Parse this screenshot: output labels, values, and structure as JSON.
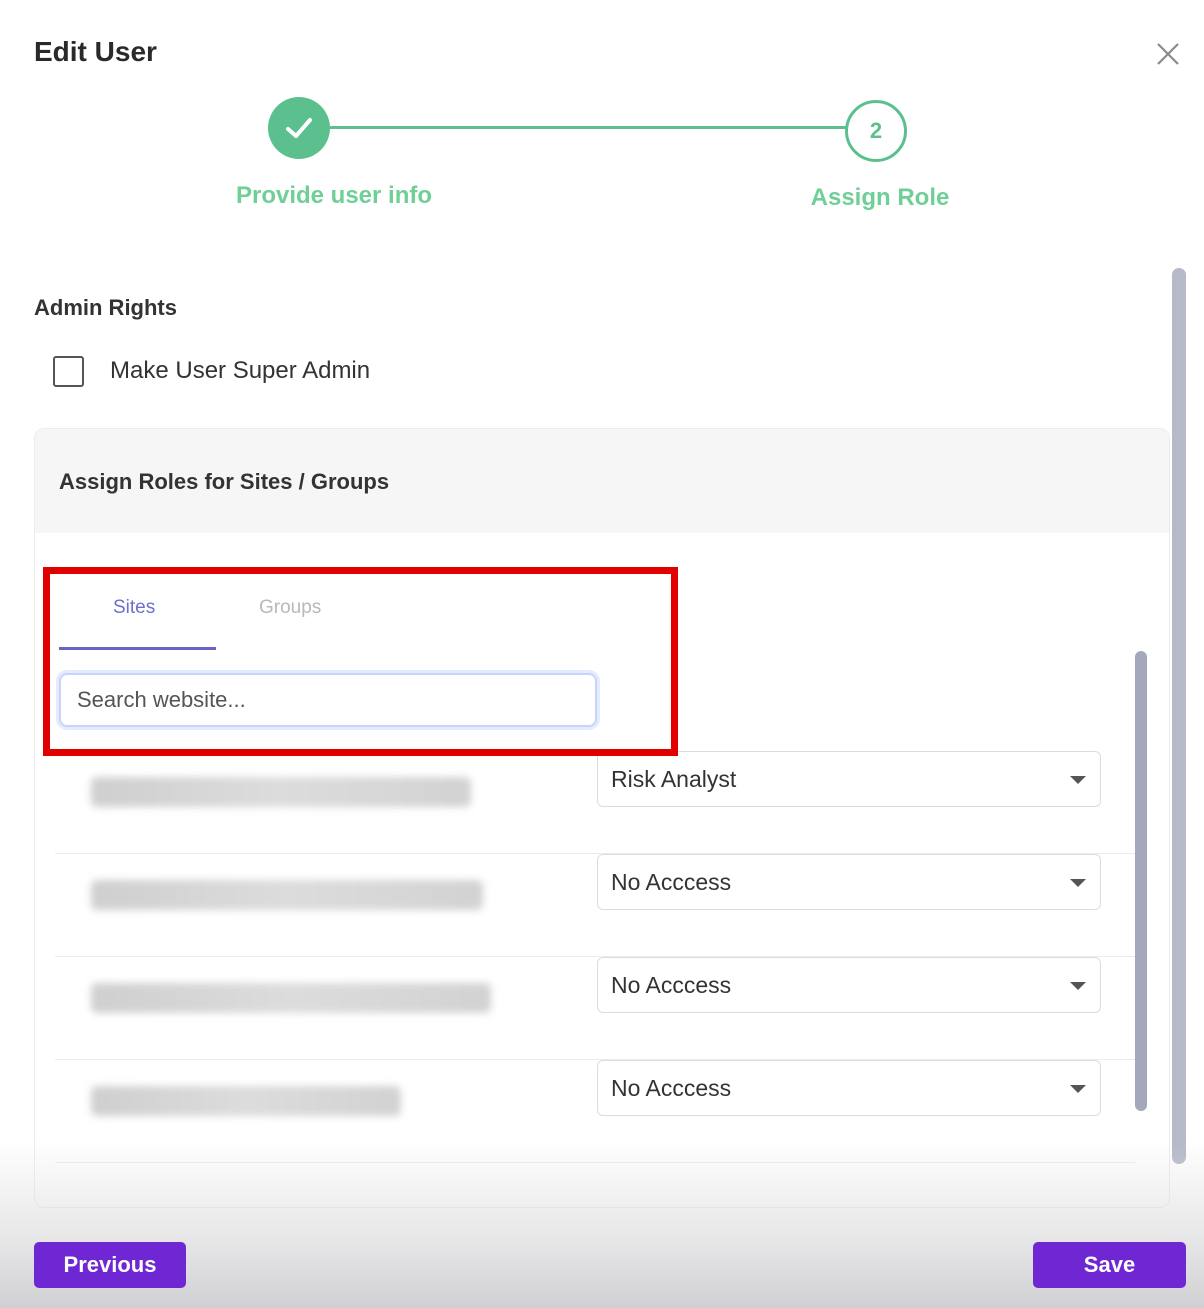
{
  "dialog": {
    "title": "Edit User",
    "close_icon": "close-icon"
  },
  "stepper": {
    "steps": [
      {
        "label": "Provide user info",
        "status": "completed",
        "icon": "check-icon"
      },
      {
        "label": "Assign Role",
        "status": "current",
        "number": "2"
      }
    ],
    "color": "#5cc08e"
  },
  "admin_rights": {
    "title": "Admin Rights",
    "checkbox_label": "Make User Super Admin",
    "checked": false
  },
  "roles": {
    "title": "Assign Roles for Sites / Groups",
    "tabs": [
      {
        "label": "Sites",
        "active": true
      },
      {
        "label": "Groups",
        "active": false
      }
    ],
    "search": {
      "placeholder": "Search website...",
      "value": ""
    },
    "rows": [
      {
        "site": "blurred-site-name",
        "role": "Risk Analyst"
      },
      {
        "site": "blurred-site-name",
        "role": "No Acccess"
      },
      {
        "site": "blurred-site-name",
        "role": "No Acccess"
      },
      {
        "site": "blurred-site-name",
        "role": "No Acccess"
      }
    ]
  },
  "footer": {
    "previous_label": "Previous",
    "save_label": "Save",
    "accent": "#6f27d4"
  }
}
